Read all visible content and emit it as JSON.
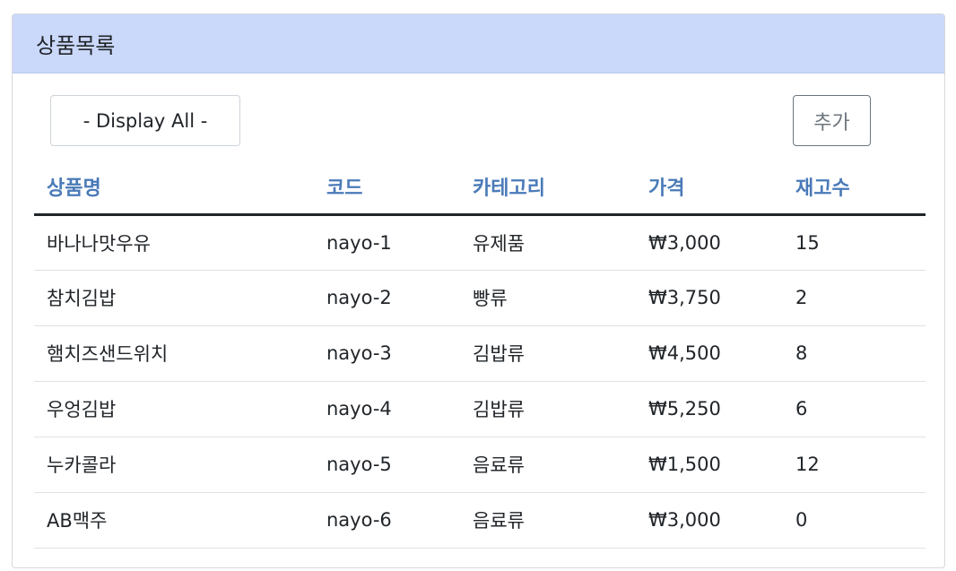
{
  "header": {
    "title": "상품목록"
  },
  "toolbar": {
    "filter_selected": "- Display All -",
    "add_label": "추가"
  },
  "table": {
    "columns": [
      "상품명",
      "코드",
      "카테고리",
      "가격",
      "재고수"
    ],
    "rows": [
      [
        "바나나맛우유",
        "nayo-1",
        "유제품",
        "₩3,000",
        "15"
      ],
      [
        "참치김밥",
        "nayo-2",
        "빵류",
        "₩3,750",
        "2"
      ],
      [
        "햄치즈샌드위치",
        "nayo-3",
        "김밥류",
        "₩4,500",
        "8"
      ],
      [
        "우엉김밥",
        "nayo-4",
        "김밥류",
        "₩5,250",
        "6"
      ],
      [
        "누카콜라",
        "nayo-5",
        "음료류",
        "₩1,500",
        "12"
      ],
      [
        "AB맥주",
        "nayo-6",
        "음료류",
        "₩3,000",
        "0"
      ]
    ]
  },
  "colors": {
    "header_bg": "#cad8fa",
    "column_header_text": "#4a7ab8",
    "header_rule": "#212529",
    "row_divider": "#dee2e6",
    "add_button_border": "#6c757d"
  }
}
